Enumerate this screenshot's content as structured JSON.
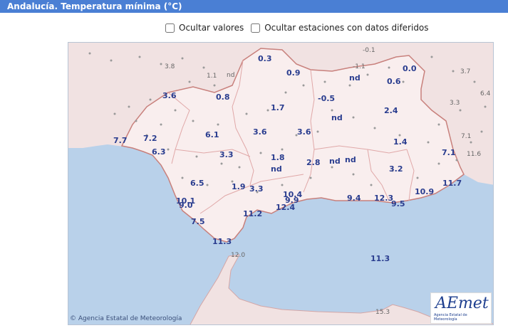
{
  "header": {
    "title": "Andalucía. Temperatura mínima (°C)"
  },
  "filters": {
    "hide_values_label": "Ocultar valores",
    "hide_deferred_label": "Ocultar estaciones con datos diferidos"
  },
  "map": {
    "copyright": "Agencia Estatal de Meteorología",
    "logo_text": "AEmet",
    "logo_subtext": "Agencia Estatal de Meteorología",
    "stations": [
      {
        "label": "3.8",
        "small": true
      },
      {
        "label": "1.1",
        "small": true
      },
      {
        "label": "nd",
        "small": true
      },
      {
        "label": "0.3"
      },
      {
        "label": "-0.1",
        "small": true
      },
      {
        "label": "-1.1",
        "small": true
      },
      {
        "label": "0.0"
      },
      {
        "label": "3.7",
        "small": true
      },
      {
        "label": "0.9"
      },
      {
        "label": "nd"
      },
      {
        "label": "0.6"
      },
      {
        "label": "6.4",
        "small": true
      },
      {
        "label": "3.6"
      },
      {
        "label": "0.8"
      },
      {
        "label": "-0.5"
      },
      {
        "label": "3.3",
        "small": true
      },
      {
        "label": "1.7"
      },
      {
        "label": "2.4"
      },
      {
        "label": "nd"
      },
      {
        "label": "6.1"
      },
      {
        "label": "3.6"
      },
      {
        "label": "3.6"
      },
      {
        "label": "7.1",
        "small": true
      },
      {
        "label": "7.7"
      },
      {
        "label": "7.2"
      },
      {
        "label": "1.4"
      },
      {
        "label": "6.3"
      },
      {
        "label": "3.3"
      },
      {
        "label": "1.8"
      },
      {
        "label": "7.1"
      },
      {
        "label": "11.6",
        "small": true
      },
      {
        "label": "2.8"
      },
      {
        "label": "nd"
      },
      {
        "label": "nd"
      },
      {
        "label": "nd"
      },
      {
        "label": "3.2"
      },
      {
        "label": "6.5"
      },
      {
        "label": "1.9"
      },
      {
        "label": "3.3"
      },
      {
        "label": "11.7"
      },
      {
        "label": "10.4"
      },
      {
        "label": "10.9"
      },
      {
        "label": "9.9"
      },
      {
        "label": "9.4"
      },
      {
        "label": "12.3"
      },
      {
        "label": "10.1"
      },
      {
        "label": "9.0"
      },
      {
        "label": "12.4"
      },
      {
        "label": "9.5"
      },
      {
        "label": "11.2"
      },
      {
        "label": "7.5"
      },
      {
        "label": "11.3"
      },
      {
        "label": "12.0",
        "small": true
      },
      {
        "label": "11.3"
      },
      {
        "label": "15.3",
        "small": true
      }
    ]
  }
}
